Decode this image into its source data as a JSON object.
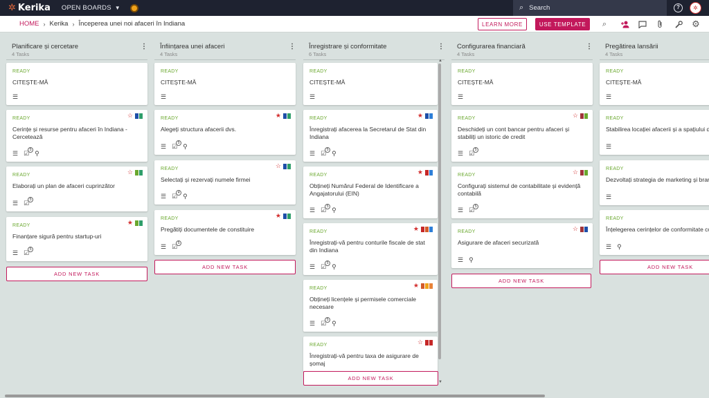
{
  "topbar": {
    "logo_text": "Kerika",
    "open_boards_label": "OPEN BOARDS",
    "search_placeholder": "Search"
  },
  "breadcrumb": {
    "home": "HOME",
    "items": [
      "Kerika",
      "Începerea unei noi afaceri în Indiana"
    ]
  },
  "actions": {
    "learn_more": "LEARN MORE",
    "use_template": "USE TEMPLATE"
  },
  "colors": {
    "accent": "#c2185b",
    "ready": "#6aa82e",
    "topbar": "#1e2230",
    "board_bg": "#d9e1df"
  },
  "add_task_label": "ADD NEW TASK",
  "columns": [
    {
      "title": "Planificare și cercetare",
      "count": "4 Tasks",
      "cards": [
        {
          "status": "READY",
          "title": "CITEȘTE-MĂ",
          "icons": [
            "desc"
          ],
          "star": null,
          "flags": []
        },
        {
          "status": "READY",
          "title": "Cerințe și resurse pentru afaceri în Indiana - Cercetează",
          "icons": [
            "desc",
            "check",
            "clip"
          ],
          "check_count": "5",
          "star": "outline",
          "flags": [
            "#1e4fa8",
            "#2e9e6a"
          ]
        },
        {
          "status": "READY",
          "title": "Elaborați un plan de afaceri cuprinzător",
          "icons": [
            "desc",
            "check"
          ],
          "check_count": "5",
          "star": "outline",
          "flags": [
            "#6aa82e",
            "#2e9e6a"
          ]
        },
        {
          "status": "READY",
          "title": "Finanțare sigură pentru startup-uri",
          "icons": [
            "desc",
            "check"
          ],
          "check_count": "5",
          "star": "filled",
          "flags": [
            "#6aa82e",
            "#2e9e6a"
          ]
        }
      ]
    },
    {
      "title": "Înființarea unei afaceri",
      "count": "4 Tasks",
      "cards": [
        {
          "status": "READY",
          "title": "CITEȘTE-MĂ",
          "icons": [
            "desc"
          ],
          "star": null,
          "flags": []
        },
        {
          "status": "READY",
          "title": "Alegeți structura afacerii dvs.",
          "icons": [
            "desc",
            "check",
            "clip"
          ],
          "check_count": "5",
          "star": "filled",
          "flags": [
            "#1e4fa8",
            "#2e9e6a"
          ]
        },
        {
          "status": "READY",
          "title": "Selectați și rezervați numele firmei",
          "icons": [
            "desc",
            "check",
            "clip"
          ],
          "check_count": "4",
          "star": "outline",
          "flags": [
            "#1e4fa8",
            "#2e9e6a"
          ]
        },
        {
          "status": "READY",
          "title": "Pregătiți documentele de constituire",
          "icons": [
            "desc",
            "check"
          ],
          "check_count": "5",
          "star": "filled",
          "flags": [
            "#1e4fa8",
            "#2e9e6a"
          ]
        }
      ]
    },
    {
      "title": "Înregistrare și conformitate",
      "count": "6 Tasks",
      "cards": [
        {
          "status": "READY",
          "title": "CITEȘTE-MĂ",
          "icons": [
            "desc"
          ],
          "star": null,
          "flags": []
        },
        {
          "status": "READY",
          "title": "Înregistrați afacerea la Secretarul de Stat din Indiana",
          "icons": [
            "desc",
            "check",
            "clip"
          ],
          "check_count": "5",
          "star": "filled",
          "flags": [
            "#1e4fa8",
            "#2e7fd8"
          ]
        },
        {
          "status": "READY",
          "title": "Obțineți Numărul Federal de Identificare a Angajatorului (EIN)",
          "icons": [
            "desc",
            "check",
            "clip"
          ],
          "check_count": "5",
          "star": "filled",
          "flags": [
            "#c62828",
            "#2e7fd8"
          ]
        },
        {
          "status": "READY",
          "title": "Înregistrați-vă pentru conturile fiscale de stat din Indiana",
          "icons": [
            "desc",
            "check",
            "clip"
          ],
          "check_count": "5",
          "star": "filled",
          "flags": [
            "#c62828",
            "#d35b2a",
            "#2e7fd8"
          ]
        },
        {
          "status": "READY",
          "title": "Obțineți licențele și permisele comerciale necesare",
          "icons": [
            "desc",
            "check",
            "clip"
          ],
          "check_count": "5",
          "star": "filled",
          "flags": [
            "#d35b2a",
            "#f0a21a",
            "#e8833a"
          ]
        },
        {
          "status": "READY",
          "title": "Înregistrați-vă pentru taxa de asigurare de șomaj",
          "icons": [],
          "star": "outline",
          "flags": [
            "#c62828",
            "#c62828"
          ]
        }
      ]
    },
    {
      "title": "Configurarea financiară",
      "count": "4 Tasks",
      "cards": [
        {
          "status": "READY",
          "title": "CITEȘTE-MĂ",
          "icons": [
            "desc"
          ],
          "star": null,
          "flags": []
        },
        {
          "status": "READY",
          "title": "Deschideți un cont bancar pentru afaceri și stabiliți un istoric de credit",
          "icons": [
            "desc",
            "check"
          ],
          "check_count": "5",
          "star": "outline",
          "flags": [
            "#a0343a",
            "#6aa82e"
          ]
        },
        {
          "status": "READY",
          "title": "Configurați sistemul de contabilitate și evidență contabilă",
          "icons": [
            "desc",
            "check"
          ],
          "check_count": "5",
          "star": "outline",
          "flags": [
            "#a0343a",
            "#6aa82e"
          ]
        },
        {
          "status": "READY",
          "title": "Asigurare de afaceri securizată",
          "icons": [
            "desc",
            "clip"
          ],
          "star": "outline",
          "flags": [
            "#a0343a",
            "#1e4fa8"
          ]
        }
      ]
    },
    {
      "title": "Pregătirea lansării",
      "count": "4 Tasks",
      "cards": [
        {
          "status": "READY",
          "title": "CITEȘTE-MĂ",
          "icons": [
            "desc"
          ],
          "star": null,
          "flags": []
        },
        {
          "status": "READY",
          "title": "Stabilirea locației afacerii și a spațiului de lucru",
          "icons": [
            "desc"
          ],
          "star": null,
          "flags": []
        },
        {
          "status": "READY",
          "title": "Dezvoltați strategia de marketing și branding",
          "icons": [
            "desc"
          ],
          "star": null,
          "flags": []
        },
        {
          "status": "READY",
          "title": "Înțelegerea cerințelor de conformitate continuă",
          "icons": [
            "desc",
            "clip"
          ],
          "star": null,
          "flags": []
        }
      ]
    }
  ]
}
